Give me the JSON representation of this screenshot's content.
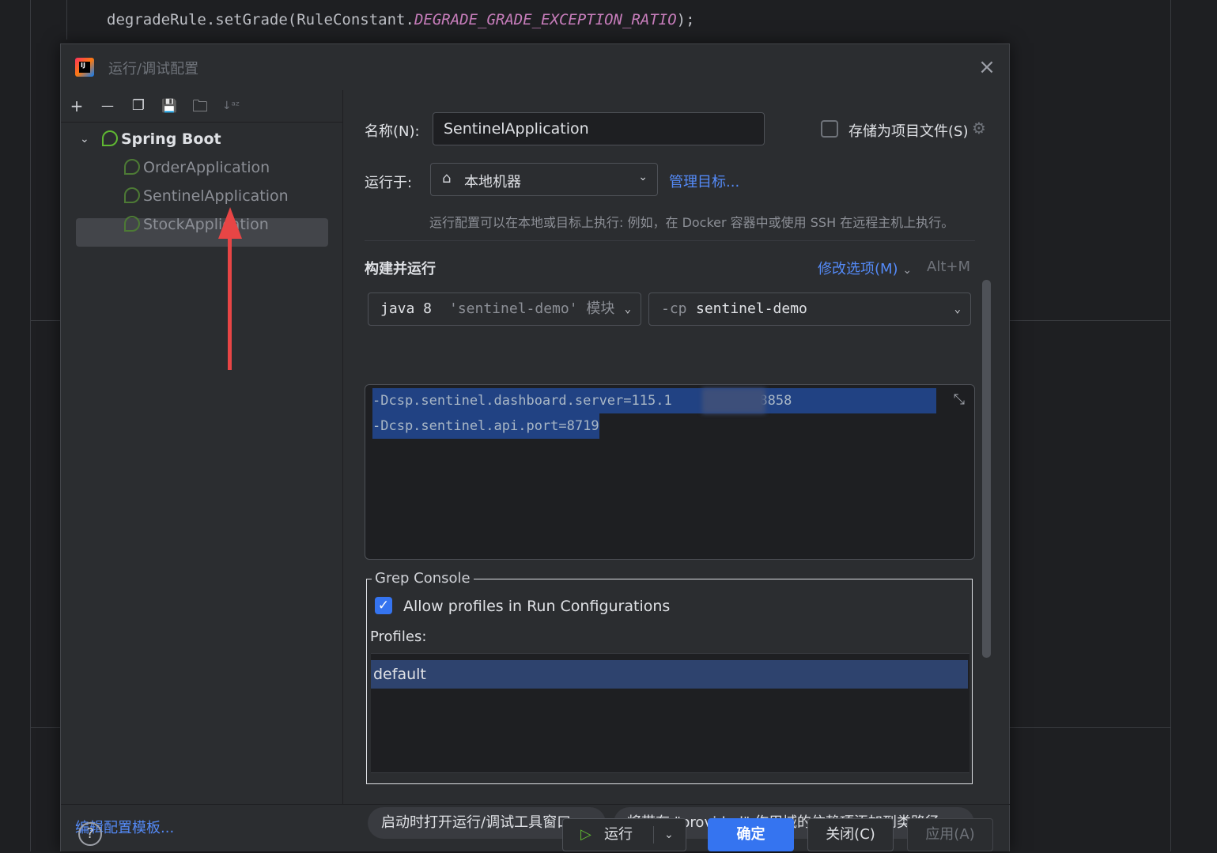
{
  "editor": {
    "line1": {
      "obj": "degradeRule.setGrade(",
      "cls": "RuleConstant.",
      "const": "DEGRADE_GRADE_EXCEPTION_RATIO",
      "end": ");"
    }
  },
  "dialog": {
    "title": "运行/调试配置",
    "close_icon": "×",
    "logo_text": "IJ"
  },
  "toolbar": {
    "add": "+",
    "remove": "—",
    "copy": "❐",
    "save": "💾",
    "folder": "🗀",
    "sort": "↓ᵃᶻ"
  },
  "tree": {
    "group": "Spring Boot",
    "items": [
      {
        "label": "OrderApplication"
      },
      {
        "label": "SentinelApplication"
      },
      {
        "label": "StockApplication"
      }
    ]
  },
  "left_footer": {
    "edit_templates": "编辑配置模板..."
  },
  "form": {
    "name_label": "名称(N):",
    "name_value": "SentinelApplication",
    "store_label": "存储为项目文件(S)",
    "run_on_label": "运行于:",
    "run_on_value": "本地机器",
    "manage_targets": "管理目标...",
    "run_hint": "运行配置可以在本地或目标上执行: 例如，在 Docker 容器中或使用 SSH 在远程主机上执行。",
    "build_run_title": "构建并运行",
    "modify_options": "修改选项(M)",
    "modify_shortcut": "Alt+M",
    "jdk_main": "java 8",
    "jdk_module": "'sentinel-demo' 模块",
    "cp_prefix": "-cp",
    "cp_value": "sentinel-demo",
    "vm_line1": "-Dcsp.sentinel.dashboard.server=115.1",
    "vm_line1_end": "34:8858",
    "vm_line2": "-Dcsp.sentinel.api.port=8719"
  },
  "grep": {
    "legend": "Grep Console",
    "allow_label": "Allow profiles in Run Configurations",
    "profiles_label": "Profiles:",
    "profiles": [
      "default"
    ]
  },
  "chips": [
    {
      "label": "启动时打开运行/调试工具窗口"
    },
    {
      "label": "将带有 \"provided\" 作用域的依赖项添加到类路径"
    }
  ],
  "footer": {
    "help": "?",
    "run": "运行",
    "ok": "确定",
    "close": "关闭(C)",
    "apply": "应用(A)"
  },
  "colors": {
    "accent": "#3574f0",
    "link": "#548af7",
    "selection": "#214283",
    "annotation_arrow": "#e84545"
  }
}
